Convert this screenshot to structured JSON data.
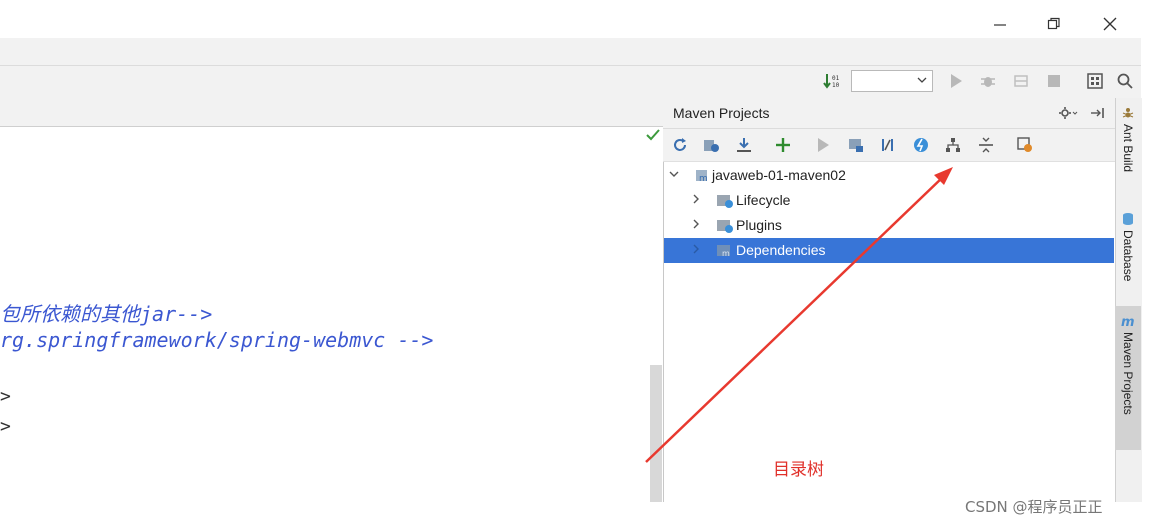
{
  "editor": {
    "code_lines": [
      "包所依赖的其他jar-->",
      "rg.springframework/spring-webmvc -->"
    ],
    "bracket_lines": [
      ">",
      ">"
    ]
  },
  "maven_panel": {
    "title": "Maven Projects",
    "tree": {
      "root": "javaweb-01-maven02",
      "children": [
        "Lifecycle",
        "Plugins",
        "Dependencies"
      ],
      "selected": "Dependencies"
    }
  },
  "side_tabs": [
    "Ant Build",
    "Database",
    "Maven Projects"
  ],
  "annotation": "目录树",
  "watermark": "CSDN @程序员正正",
  "colors": {
    "selection": "#3875d7",
    "code": "#3b57d1",
    "annotation": "#e0302a"
  }
}
